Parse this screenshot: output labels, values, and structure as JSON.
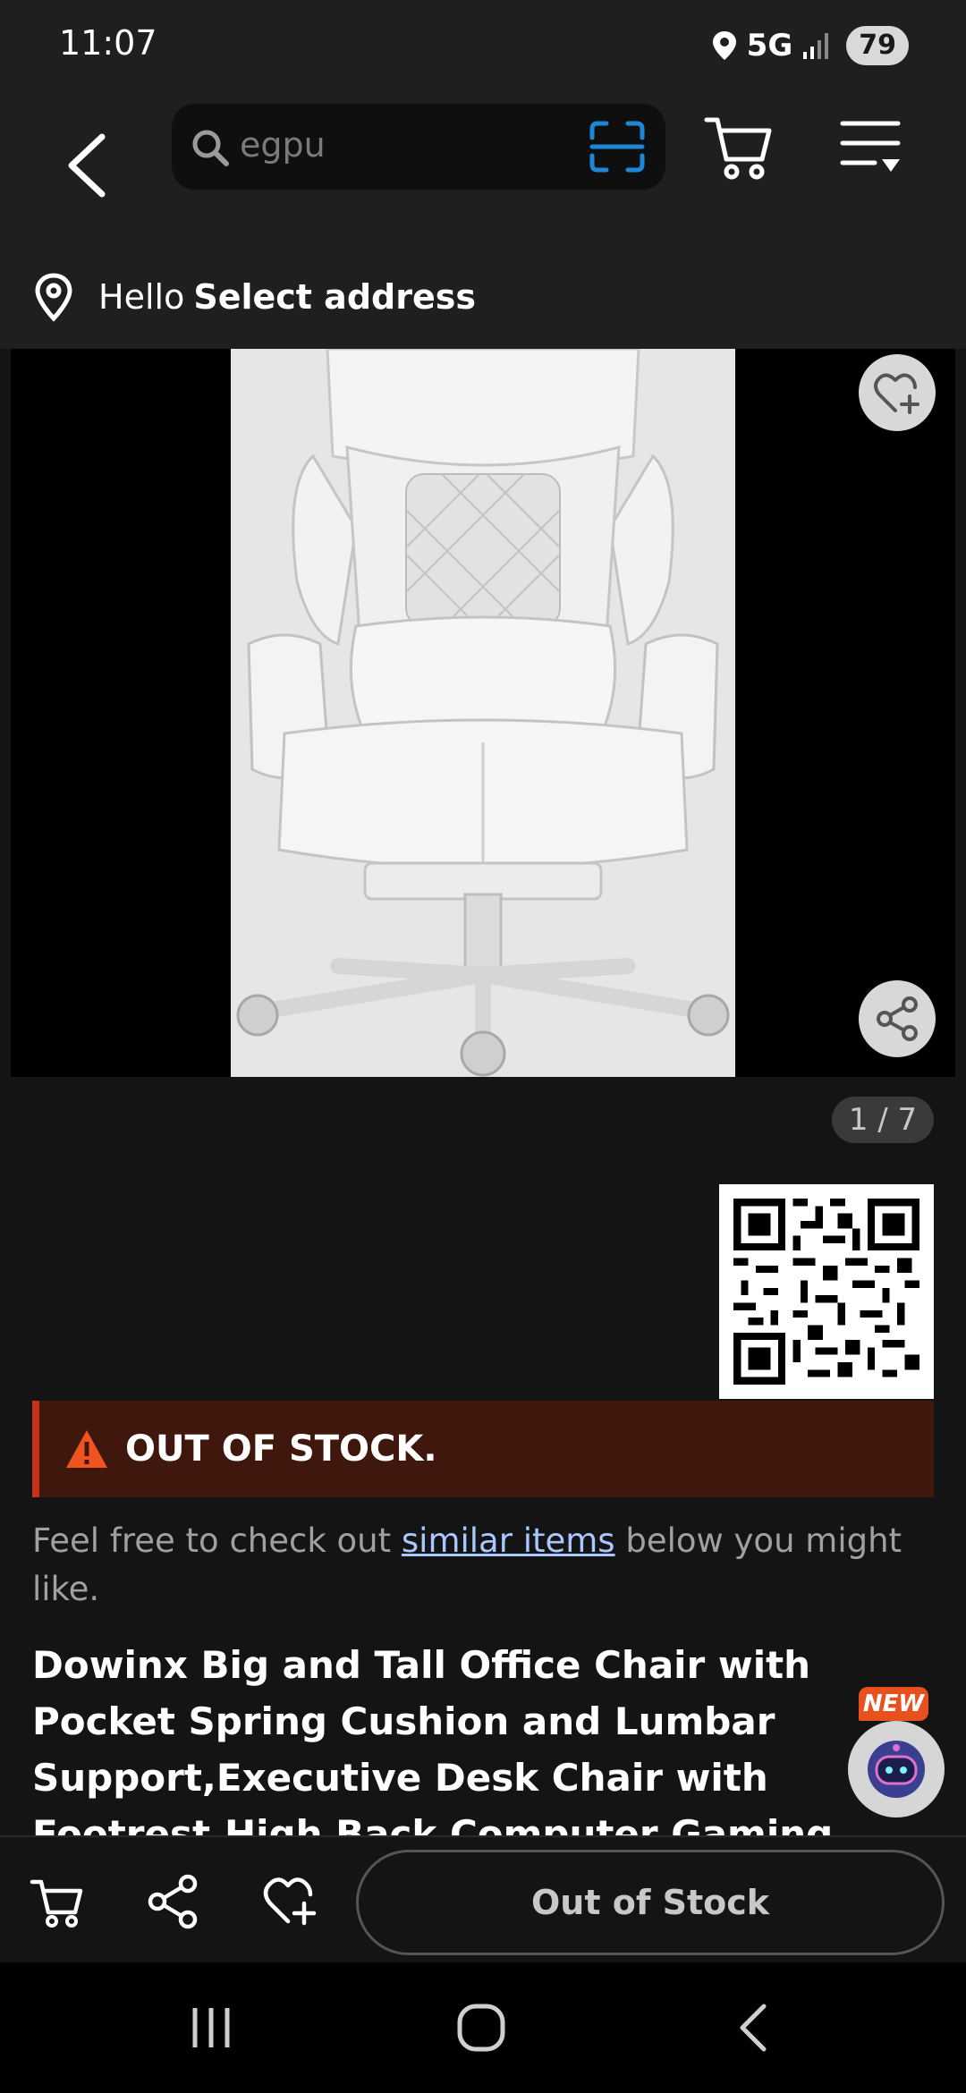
{
  "status_bar": {
    "time": "11:07",
    "network": "5G",
    "battery": "79"
  },
  "header": {
    "search": {
      "value": "egpu"
    },
    "address": {
      "hello": "Hello",
      "select": "Select address"
    }
  },
  "gallery": {
    "counter": "1 / 7"
  },
  "stock": {
    "banner": "OUT OF STOCK.",
    "note_prefix": "Feel free to check out ",
    "note_link": "similar items",
    "note_suffix": " below you might like."
  },
  "product": {
    "title": "Dowinx Big and Tall Office Chair with Pocket Spring Cushion and Lumbar Support,Executive Desk Chair with Footrest,High Back Computer Gaming Chair"
  },
  "assistant": {
    "badge": "NEW"
  },
  "bottom_bar": {
    "button_label": "Out of Stock"
  },
  "colors": {
    "background": "#141414",
    "banner_bg": "#3f170d",
    "banner_accent": "#c4301a",
    "warning": "#f0541e",
    "link": "#a8c8ff",
    "scan_accent": "#1e88d8"
  }
}
